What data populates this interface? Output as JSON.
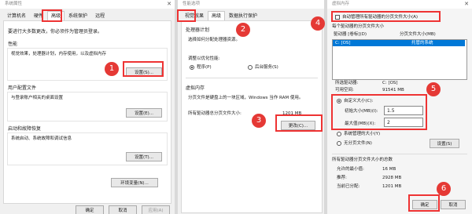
{
  "w1": {
    "title": "系统属性",
    "tabs": [
      "计算机名",
      "硬件",
      "高级",
      "系统保护",
      "远程"
    ],
    "note": "要进行大多数更改，你必须作为管理员登录。",
    "perf_title": "性能",
    "perf_desc": "视觉效果，处理器计划，内存使用，以及虚拟内存",
    "perf_btn": "设置(S)...",
    "profile_title": "用户配置文件",
    "profile_desc": "与登录账户相关的桌面设置",
    "profile_btn": "设置(E)...",
    "startup_title": "启动和故障恢复",
    "startup_desc": "系统启动、系统故障和调试信息",
    "startup_btn": "设置(T)...",
    "env_btn": "环境变量(N)...",
    "ok": "确定",
    "cancel": "取消",
    "apply": "应用(A)"
  },
  "w2": {
    "title": "性能选项",
    "tabs": [
      "视觉效果",
      "高级",
      "数据执行保护"
    ],
    "sched_title": "处理器计划",
    "sched_desc": "选择如何分配处理器资源。",
    "sched_label": "调整以优化性能:",
    "opt_programs": "程序(P)",
    "opt_services": "后台服务(S)",
    "vm_title": "虚拟内存",
    "vm_desc1": "分页文件是硬盘上的一块区域，Windows 当作 RAM 使用。",
    "vm_total_label": "所有驱动器总分页文件大小:",
    "vm_total_value": "1201 MB",
    "change_btn": "更改(C)..."
  },
  "w3": {
    "title": "虚拟内存",
    "auto_manage": "自动管理所有驱动器的分页文件大小(A)",
    "each_drive": "每个驱动器的分页文件大小",
    "col_drive": "驱动器 [卷标](D)",
    "col_size": "分页文件大小(MB)",
    "drive_row": "C:     [OS]",
    "drive_row_size": "托管的系统",
    "selected_drive_label": "所选驱动器:",
    "selected_drive_value": "C: [OS]",
    "free_space_label": "可用空间:",
    "free_space_value": "91541 MB",
    "custom_size": "自定义大小(C):",
    "initial_label": "初始大小(MB)(I):",
    "initial_value": "1.5",
    "max_label": "最大值(MB)(X):",
    "max_value": "2",
    "system_managed": "系统管理的大小(Y)",
    "no_paging": "无分页文件(N)",
    "set_btn": "设置(S)",
    "total_title": "所有驱动器分页文件大小的总数",
    "min_label": "允许的最小值:",
    "min_value": "16 MB",
    "rec_label": "推荐:",
    "rec_value": "2928 MB",
    "cur_label": "当前已分配:",
    "cur_value": "1201 MB",
    "ok": "确定",
    "cancel": "取消"
  },
  "badges": [
    "1",
    "2",
    "3",
    "4",
    "5",
    "6"
  ]
}
